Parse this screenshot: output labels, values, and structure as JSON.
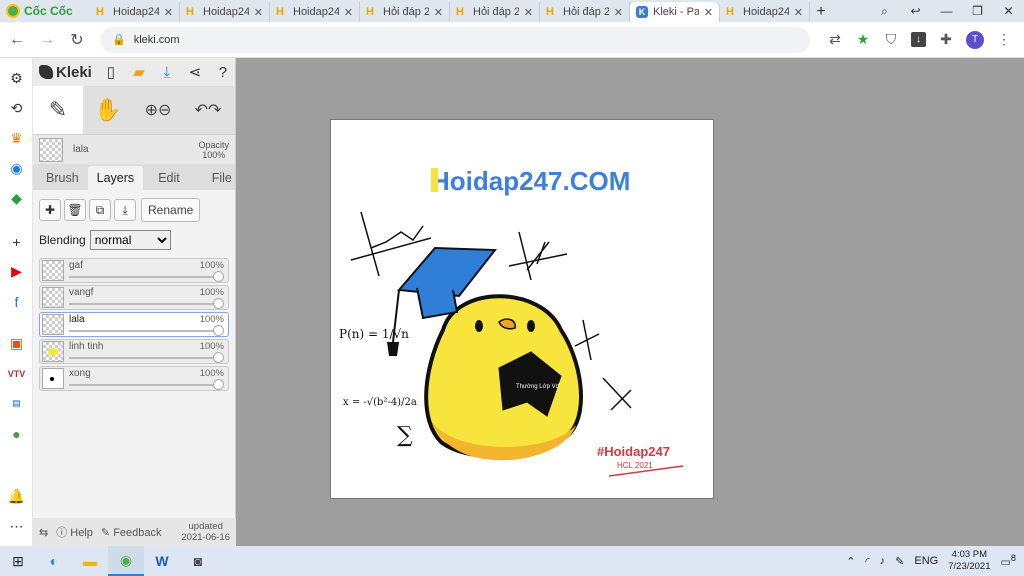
{
  "browser": {
    "brand": "Cốc Cốc",
    "tabs": [
      {
        "title": "Hoidap24",
        "icon": "H",
        "active": false
      },
      {
        "title": "Hoidap24",
        "icon": "H",
        "active": false
      },
      {
        "title": "Hoidap24",
        "icon": "H",
        "active": false
      },
      {
        "title": "Hỏi đáp 2",
        "icon": "H",
        "active": false
      },
      {
        "title": "Hỏi đáp 2",
        "icon": "H",
        "active": false
      },
      {
        "title": "Hỏi đáp 2",
        "icon": "H",
        "active": false
      },
      {
        "title": "Kleki - Pa",
        "icon": "K",
        "active": true
      },
      {
        "title": "Hoidap24",
        "icon": "H",
        "active": false
      }
    ],
    "new_tab": "+",
    "url": "kleki.com",
    "profile_initial": "T"
  },
  "kleki": {
    "app_name": "Kleki",
    "current_layer": {
      "name": "lala",
      "opacity_label": "Opacity",
      "opacity_value": "100%"
    },
    "tabs": [
      "Brush",
      "Layers",
      "Edit",
      "File"
    ],
    "active_tab": "Layers",
    "rename_label": "Rename",
    "blending_label": "Blending",
    "blending_value": "normal",
    "blending_options": [
      "normal"
    ],
    "layers": [
      {
        "name": "gaf",
        "opacity": "100%",
        "selected": false
      },
      {
        "name": "vangf",
        "opacity": "100%",
        "selected": false
      },
      {
        "name": "lala",
        "opacity": "100%",
        "selected": true
      },
      {
        "name": "linh tinh",
        "opacity": "100%",
        "selected": false
      },
      {
        "name": "xong",
        "opacity": "100%",
        "selected": false
      }
    ],
    "footer": {
      "help": "Help",
      "feedback": "Feedback",
      "updated_label": "updated",
      "updated_date": "2021-06-16"
    }
  },
  "drawing": {
    "brand_text": "Hoidap247.COM",
    "formula_p": "P(n) = 1/√n",
    "formula_x": "x = -√(b²-4)/2a",
    "sum_symbol": "∑",
    "book_text": "Thường Lớp Vd",
    "hashtag": "#Hoidap247",
    "signature": "HCL 2021"
  },
  "taskbar": {
    "language": "ENG",
    "time": "4:03 PM",
    "date": "7/23/2021",
    "notification_count": "8"
  },
  "colors": {
    "workspace": "#9e9e9e",
    "panel": "#e6e6e6",
    "duck_yellow": "#f7e43c",
    "cap_blue": "#2f7fd9",
    "hashtag_red": "#d9363e"
  }
}
